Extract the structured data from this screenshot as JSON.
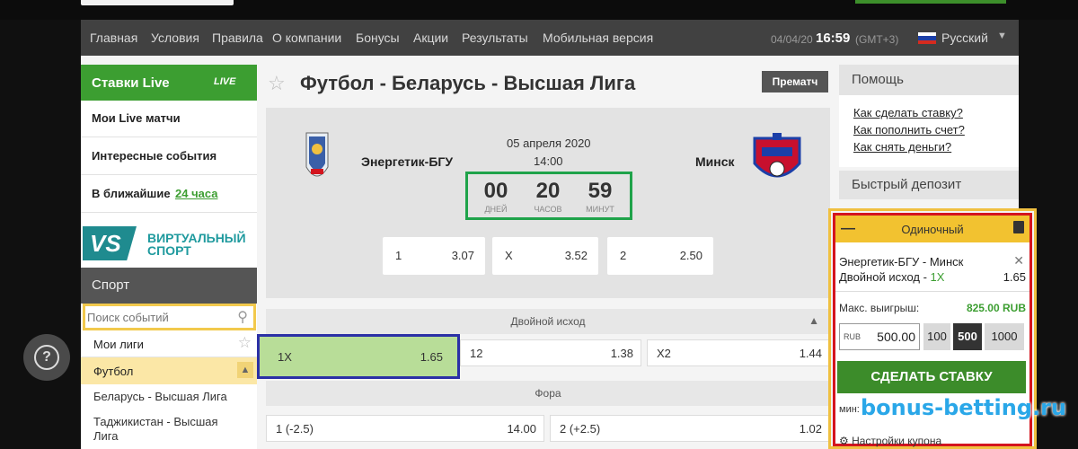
{
  "nav": {
    "items": [
      "Главная",
      "Условия",
      "Правила",
      "О компании",
      "Бонусы",
      "Акции",
      "Результаты",
      "Мобильная версия"
    ],
    "date": "04/04/20",
    "time": "16:59",
    "tz": "(GMT+3)",
    "language": "Русский"
  },
  "sidebar": {
    "live_title": "Ставки Live",
    "live_logo": "LIVE",
    "my_live": "Мои Live матчи",
    "interesting": "Интересные события",
    "upcoming_prefix": "В ближайшие",
    "upcoming_link": "24 часа",
    "vs_badge": "VS",
    "virtual_line1": "ВИРТУАЛЬНЫЙ",
    "virtual_line2": "СПОРТ",
    "sport_title": "Спорт",
    "search_placeholder": "Поиск событий",
    "my_leagues": "Мои лиги",
    "football": "Футбол",
    "leagues": [
      "Беларусь - Высшая Лига",
      "Таджикистан - Высшая Лига"
    ]
  },
  "main": {
    "title": "Футбол - Беларусь - Высшая Лига",
    "prematch": "Прематч",
    "home_team": "Энергетик-БГУ",
    "away_team": "Минск",
    "date": "05 апреля 2020",
    "time": "14:00",
    "countdown": {
      "days": "00",
      "days_label": "ДНЕЙ",
      "hours": "20",
      "hours_label": "ЧАСОВ",
      "minutes": "59",
      "minutes_label": "МИНУТ"
    },
    "odds": [
      {
        "label": "1",
        "value": "3.07"
      },
      {
        "label": "X",
        "value": "3.52"
      },
      {
        "label": "2",
        "value": "2.50"
      }
    ],
    "markets": [
      {
        "title": "Двойной исход",
        "outcomes": [
          {
            "label": "1X",
            "value": "1.65"
          },
          {
            "label": "12",
            "value": "1.38"
          },
          {
            "label": "X2",
            "value": "1.44"
          }
        ]
      },
      {
        "title": "Фора",
        "outcomes": [
          {
            "label": "1 (-2.5)",
            "value": "14.00"
          },
          {
            "label": "2 (+2.5)",
            "value": "1.02"
          }
        ]
      }
    ]
  },
  "right": {
    "help_title": "Помощь",
    "help_links": [
      "Как сделать ставку?",
      "Как пополнить счет?",
      "Как снять деньги?"
    ],
    "deposit_title": "Быстрый депозит"
  },
  "betslip": {
    "title": "Одиночный",
    "minimize": "—",
    "match": "Энергетик-БГУ - Минск",
    "bet_type": "Двойной исход - ",
    "bet_pick": "1X",
    "odd": "1.65",
    "max_win_label": "Макс. выигрыш:",
    "max_win_value": "825.00 RUB",
    "currency": "RUB",
    "stake": "500.00",
    "quick_amounts": [
      "100",
      "500",
      "1000"
    ],
    "place_bet": "СДЕЛАТЬ СТАВКУ",
    "min_label": "мин:",
    "settings": "Настройки купона"
  },
  "watermark": "bonus-betting.ru",
  "colors": {
    "accent_green": "#3c9e31",
    "slip_yellow": "#f2c230",
    "highlight_red": "#d4141e",
    "highlight_blue": "#2b30a6",
    "highlight_orange": "#f0c040"
  }
}
